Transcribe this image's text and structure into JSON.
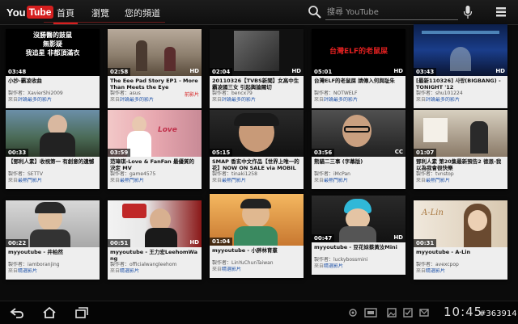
{
  "app": {
    "logo_you": "You",
    "logo_tube": "Tube"
  },
  "tabs": [
    {
      "label": "首頁"
    },
    {
      "label": "瀏覽"
    },
    {
      "label": "您的頻道"
    }
  ],
  "search": {
    "placeholder": "搜尋 YouTube"
  },
  "colors": {
    "brand_red": "#d51f1f",
    "bar": "#0f0f0f"
  },
  "icons": [
    "search-icon",
    "mic-icon",
    "menu-icon",
    "back-icon",
    "home-icon",
    "recent-apps-icon"
  ],
  "videos": [
    {
      "duration": "03:48",
      "title": "小抄-霸凌收曲",
      "by": "製作者：XavierShi2009",
      "src_label": "來自",
      "src": "評論最多的影片",
      "hd": "",
      "badge": ""
    },
    {
      "duration": "02:58",
      "title": "The Eee Pad Story EP1 - More Than Meets the Eye",
      "by": "製作者：asus",
      "src_label": "來自",
      "src": "評論最多的影片",
      "hd": "HD",
      "badge": "前影片"
    },
    {
      "duration": "02:04",
      "title": "20110326【TVBS新聞】女高中生霸凌國三女 引起輿論關切",
      "by": "製作者：bencx79",
      "src_label": "來自",
      "src": "評論最多的影片",
      "hd": "HD",
      "badge": ""
    },
    {
      "duration": "05:01",
      "title": "台灣ELF的老鼠屎 請傳入何與耻朱",
      "by": "製作者：NOTWELF",
      "src_label": "來自",
      "src": "評論最多的影片",
      "hd": "HD",
      "badge": ""
    },
    {
      "duration": "03:43",
      "title": "[最新110326] 사랑(BIGBANG) - TONIGHT '12",
      "by": "製作者：shu101224",
      "src_label": "來自",
      "src": "評論最多的影片",
      "hd": "HD",
      "badge": ""
    },
    {
      "duration": "00:33",
      "title": "【鄧利人素】收視第一 有創意的遺憾",
      "by": "製作者：SETTV",
      "src_label": "來自",
      "src": "最熱門影片",
      "hd": "",
      "badge": ""
    },
    {
      "duration": "03:59",
      "title": "范瑋琪-Love & FanFan 最優質的決定 MV",
      "by": "製作者：game4575",
      "src_label": "來自",
      "src": "最熱門影片",
      "hd": "",
      "badge": ""
    },
    {
      "duration": "05:15",
      "title": "SMAP 香玄中文作品【世界上唯一的花】NOW ON SALE via MOBILE.flv",
      "by": "製作者：tinaki1258",
      "src_label": "來自",
      "src": "最熱門影片",
      "hd": "",
      "badge": ""
    },
    {
      "duration": "03:56",
      "title": "熊貓二三事 (字幕版)",
      "by": "製作者：iMcPan",
      "src_label": "來自",
      "src": "最熱門影片",
      "hd": "CC",
      "badge": ""
    },
    {
      "duration": "01:07",
      "title": "鄧利人素 第20集最新預告2 徳恩-我以為我會很快樂",
      "by": "製作者：tvnstop",
      "src_label": "來自",
      "src": "最熱門影片",
      "hd": "",
      "badge": ""
    },
    {
      "duration": "00:22",
      "title": "myyoutube - 井柏然",
      "by": "製作者：iamboranjing",
      "src_label": "來自",
      "src": "精選影片",
      "hd": "",
      "badge": ""
    },
    {
      "duration": "00:51",
      "title": "myyoutube - 王力宏LeehomWang",
      "by": "製作者：officialwangleehom",
      "src_label": "來自",
      "src": "精選影片",
      "hd": "HD",
      "badge": ""
    },
    {
      "duration": "01:04",
      "title": "myyoutube - 小胖林育羣",
      "by": "製作者：LinYuChunTaiwan",
      "src_label": "來自",
      "src": "精選影片",
      "hd": "",
      "badge": ""
    },
    {
      "duration": "00:47",
      "title": "myyoutube - 豆花妹蔡黃汝Mini",
      "by": "製作者：luckybossmini",
      "src_label": "來自",
      "src": "精選影片",
      "hd": "HD",
      "badge": ""
    },
    {
      "duration": "00:31",
      "title": "myyoutube - A-Lin",
      "by": "製作者：avexcpop",
      "src_label": "來自",
      "src": "精選影片",
      "hd": "",
      "badge": ""
    }
  ],
  "thumb_texts": {
    "t0": [
      "沒勝醫的鼓鼠",
      "無影疑",
      "我追星 非都頂滿衣"
    ],
    "t3": "台灣ELF的老鼠屎",
    "t6": "Love",
    "t14": "A-Lin"
  },
  "statusbar": {
    "clock": "10:45",
    "watermark": "#363914"
  }
}
